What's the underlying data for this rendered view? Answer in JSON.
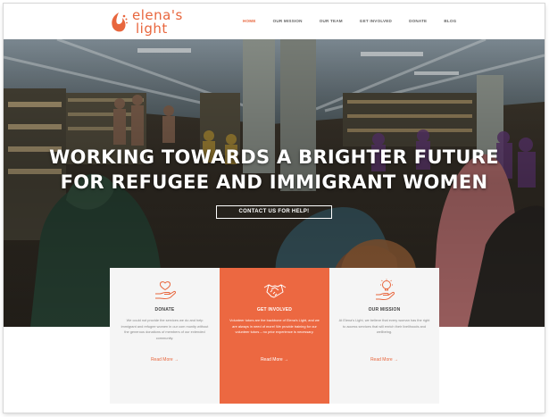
{
  "logo": {
    "line1": "elena's",
    "line2": "light"
  },
  "nav": [
    {
      "label": "HOME",
      "active": true
    },
    {
      "label": "OUR MISSION",
      "active": false
    },
    {
      "label": "OUR TEAM",
      "active": false
    },
    {
      "label": "GET INVOLVED",
      "active": false
    },
    {
      "label": "DONATE",
      "active": false
    },
    {
      "label": "BLOG",
      "active": false
    }
  ],
  "hero": {
    "title_line1": "WORKING TOWARDS A BRIGHTER FUTURE",
    "title_line2": "FOR REFUGEE AND IMMIGRANT WOMEN",
    "cta_label": "CONTACT US FOR HELP!"
  },
  "cards": [
    {
      "icon": "hand-heart-icon",
      "title": "DONATE",
      "body": "We could not provide the services we do and help immigrant and refugee women in our com munity without the generous donations of members of our extended community.",
      "more": "Read More →"
    },
    {
      "icon": "handshake-icon",
      "title": "GET INVOLVED",
      "body": "Volunteer tutors are the backbone of Elena's Light, and we are always in need of more! We provide training for our volunteer tutors – no prior experience is necessary.",
      "more": "Read More →"
    },
    {
      "icon": "hand-lightbulb-icon",
      "title": "OUR MISSION",
      "body": "At Elena's Light, we believe that every woman has the right to access services that will enrich their livelihoods and wellbeing.",
      "more": "Read More →"
    }
  ],
  "colors": {
    "accent": "#ec6841",
    "card_bg": "#f5f5f5",
    "nav_text": "#666666"
  }
}
